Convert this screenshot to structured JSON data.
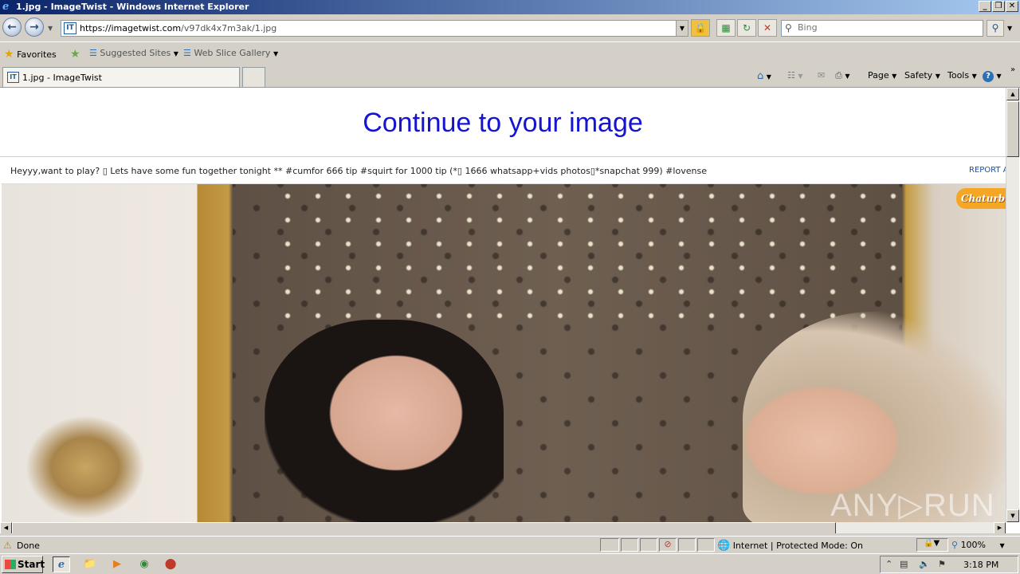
{
  "window": {
    "title": "1.jpg - ImageTwist - Windows Internet Explorer",
    "minimize": "_",
    "maximize": "❒",
    "close": "✕"
  },
  "address": {
    "url_prefix": "https://",
    "url_domain": "imagetwist.com",
    "url_path": "/v97dk4x7m3ak/1.jpg",
    "favicon": "IT"
  },
  "search": {
    "placeholder": "Bing"
  },
  "favorites": {
    "favorites_label": "Favorites",
    "suggested_sites": "Suggested Sites",
    "web_slice_gallery": "Web Slice Gallery"
  },
  "tabs": [
    {
      "label": "1.jpg - ImageTwist",
      "favicon": "IT"
    }
  ],
  "command_bar": {
    "page": "Page",
    "safety": "Safety",
    "tools": "Tools"
  },
  "page": {
    "heading": "Continue to your image",
    "info_text": "Heyyy,want to play? ▯ Lets have some fun together tonight **  #cumfor 666 tip #squirt for 1000 tip (*▯ 1666 whatsapp+vids photos▯*snapchat 999) #lovense",
    "report_link": "REPORT A",
    "logo_text": "Chaturb",
    "watermark": "ANY▷RUN"
  },
  "status": {
    "text": "Done",
    "zone": "Internet | Protected Mode: On",
    "zoom": "100%"
  },
  "taskbar": {
    "start": "Start",
    "time": "3:18 PM"
  },
  "icons": {
    "back": "back-arrow-icon",
    "forward": "forward-arrow-icon",
    "lock": "lock-icon",
    "refresh": "refresh-icon",
    "stop": "stop-icon",
    "search": "magnifier-icon",
    "home": "home-icon",
    "feeds": "rss-icon",
    "mail": "mail-icon",
    "print": "printer-icon",
    "help": "help-icon"
  },
  "colors": {
    "heading": "#1414d2",
    "report_link": "#1f4f99",
    "title_bar": "#0a246a"
  }
}
